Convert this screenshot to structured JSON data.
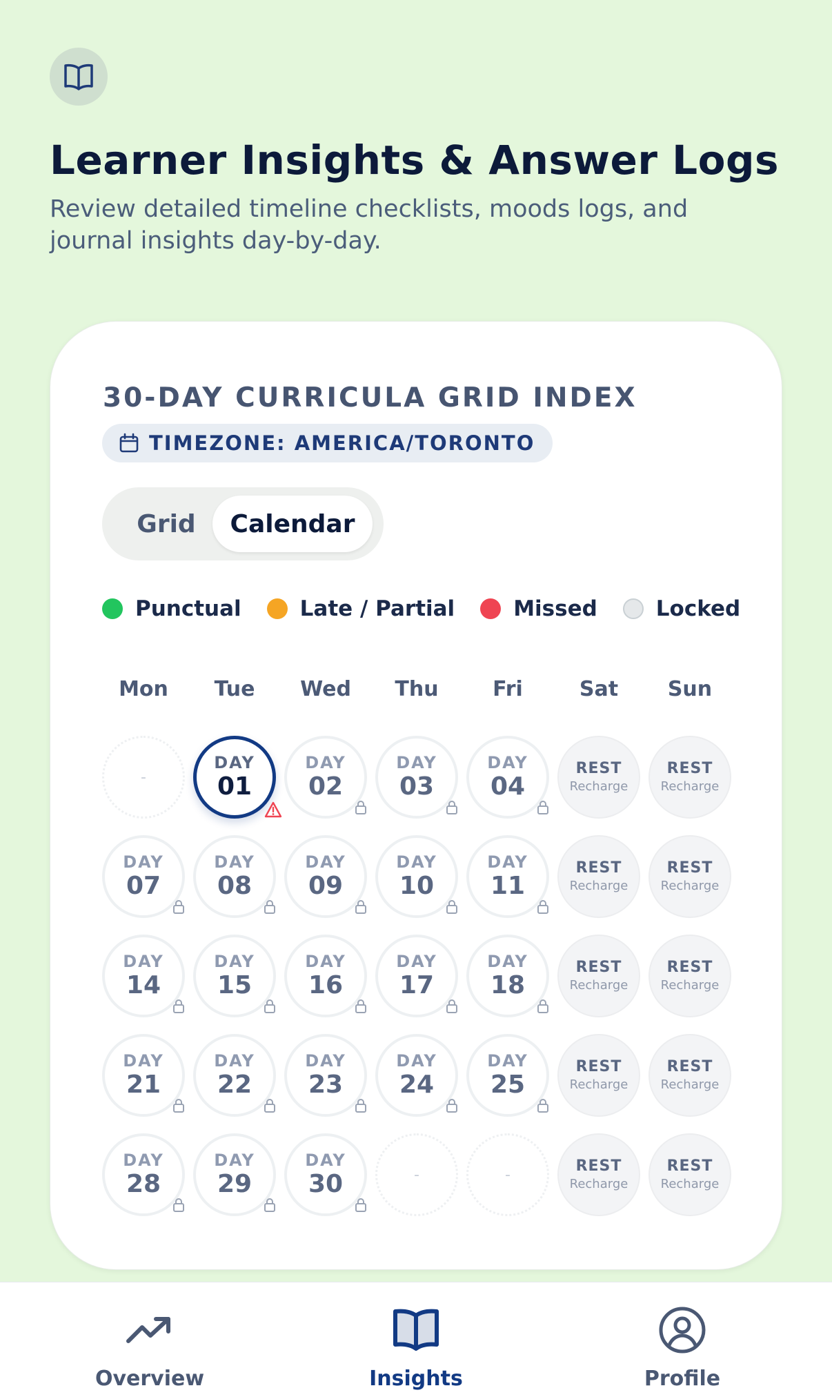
{
  "header": {
    "icon": "book-icon",
    "title": "Learner Insights & Answer Logs",
    "subtitle": "Review detailed timeline checklists, moods logs, and journal insights day-by-day."
  },
  "card": {
    "title": "30-DAY CURRICULA GRID INDEX",
    "timezone_icon": "calendar-icon",
    "timezone": "TIMEZONE: AMERICA/TORONTO",
    "toggle": {
      "grid": "Grid",
      "calendar": "Calendar",
      "selected": "Calendar"
    },
    "legend": [
      {
        "label": "Punctual",
        "color": "#22c55e"
      },
      {
        "label": "Late / Partial",
        "color": "#f5a524"
      },
      {
        "label": "Missed",
        "color": "#ef4452"
      },
      {
        "label": "Locked",
        "color": "#e5e8ea"
      }
    ],
    "weekdays": [
      "Mon",
      "Tue",
      "Wed",
      "Thu",
      "Fri",
      "Sat",
      "Sun"
    ],
    "cells": [
      {
        "type": "blank",
        "text": "-"
      },
      {
        "type": "today",
        "day": "DAY",
        "num": "01",
        "badge": "warning-icon"
      },
      {
        "type": "locked",
        "day": "DAY",
        "num": "02",
        "badge": "lock-icon"
      },
      {
        "type": "locked",
        "day": "DAY",
        "num": "03",
        "badge": "lock-icon"
      },
      {
        "type": "locked",
        "day": "DAY",
        "num": "04",
        "badge": "lock-icon"
      },
      {
        "type": "rest",
        "rest": "REST",
        "sub": "Recharge"
      },
      {
        "type": "rest",
        "rest": "REST",
        "sub": "Recharge"
      },
      {
        "type": "locked",
        "day": "DAY",
        "num": "07",
        "badge": "lock-icon"
      },
      {
        "type": "locked",
        "day": "DAY",
        "num": "08",
        "badge": "lock-icon"
      },
      {
        "type": "locked",
        "day": "DAY",
        "num": "09",
        "badge": "lock-icon"
      },
      {
        "type": "locked",
        "day": "DAY",
        "num": "10",
        "badge": "lock-icon"
      },
      {
        "type": "locked",
        "day": "DAY",
        "num": "11",
        "badge": "lock-icon"
      },
      {
        "type": "rest",
        "rest": "REST",
        "sub": "Recharge"
      },
      {
        "type": "rest",
        "rest": "REST",
        "sub": "Recharge"
      },
      {
        "type": "locked",
        "day": "DAY",
        "num": "14",
        "badge": "lock-icon"
      },
      {
        "type": "locked",
        "day": "DAY",
        "num": "15",
        "badge": "lock-icon"
      },
      {
        "type": "locked",
        "day": "DAY",
        "num": "16",
        "badge": "lock-icon"
      },
      {
        "type": "locked",
        "day": "DAY",
        "num": "17",
        "badge": "lock-icon"
      },
      {
        "type": "locked",
        "day": "DAY",
        "num": "18",
        "badge": "lock-icon"
      },
      {
        "type": "rest",
        "rest": "REST",
        "sub": "Recharge"
      },
      {
        "type": "rest",
        "rest": "REST",
        "sub": "Recharge"
      },
      {
        "type": "locked",
        "day": "DAY",
        "num": "21",
        "badge": "lock-icon"
      },
      {
        "type": "locked",
        "day": "DAY",
        "num": "22",
        "badge": "lock-icon"
      },
      {
        "type": "locked",
        "day": "DAY",
        "num": "23",
        "badge": "lock-icon"
      },
      {
        "type": "locked",
        "day": "DAY",
        "num": "24",
        "badge": "lock-icon"
      },
      {
        "type": "locked",
        "day": "DAY",
        "num": "25",
        "badge": "lock-icon"
      },
      {
        "type": "rest",
        "rest": "REST",
        "sub": "Recharge"
      },
      {
        "type": "rest",
        "rest": "REST",
        "sub": "Recharge"
      },
      {
        "type": "locked",
        "day": "DAY",
        "num": "28",
        "badge": "lock-icon"
      },
      {
        "type": "locked",
        "day": "DAY",
        "num": "29",
        "badge": "lock-icon"
      },
      {
        "type": "locked",
        "day": "DAY",
        "num": "30",
        "badge": "lock-icon"
      },
      {
        "type": "blank",
        "text": "-"
      },
      {
        "type": "blank",
        "text": "-"
      },
      {
        "type": "rest",
        "rest": "REST",
        "sub": "Recharge"
      },
      {
        "type": "rest",
        "rest": "REST",
        "sub": "Recharge"
      }
    ]
  },
  "nav": {
    "items": [
      {
        "label": "Overview",
        "icon": "trending-up-icon"
      },
      {
        "label": "Insights",
        "icon": "book-icon",
        "active": true
      },
      {
        "label": "Profile",
        "icon": "user-circle-icon"
      }
    ]
  },
  "colors": {
    "background": "#e4f7dc",
    "accent": "#123a84",
    "warning": "#ef4452"
  }
}
